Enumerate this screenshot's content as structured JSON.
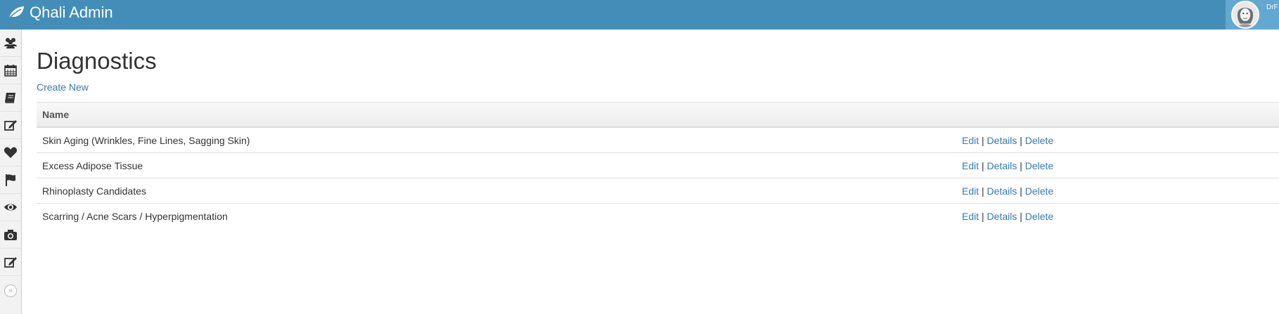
{
  "app": {
    "title": "Qhali Admin",
    "user_name": "DrF"
  },
  "sidebar": {
    "items": [
      {
        "icon": "users-icon"
      },
      {
        "icon": "calendar-icon"
      },
      {
        "icon": "book-icon"
      },
      {
        "icon": "edit-icon"
      },
      {
        "icon": "heart-icon"
      },
      {
        "icon": "flag-icon"
      },
      {
        "icon": "eye-icon"
      },
      {
        "icon": "camera-icon"
      },
      {
        "icon": "edit-icon"
      }
    ],
    "collapse_glyph": "»"
  },
  "page": {
    "title": "Diagnostics",
    "create_link": "Create New"
  },
  "table": {
    "columns": [
      "Name"
    ],
    "actions": {
      "edit": "Edit",
      "details": "Details",
      "delete": "Delete",
      "separator": "|"
    },
    "rows": [
      {
        "name": "Skin Aging (Wrinkles, Fine Lines, Sagging Skin)"
      },
      {
        "name": "Excess Adipose Tissue"
      },
      {
        "name": "Rhinoplasty Candidates"
      },
      {
        "name": "Scarring / Acne Scars / Hyperpigmentation"
      }
    ]
  },
  "colors": {
    "topbar": "#438eb9",
    "user_box": "#62a8d1",
    "link": "#337ab7"
  }
}
